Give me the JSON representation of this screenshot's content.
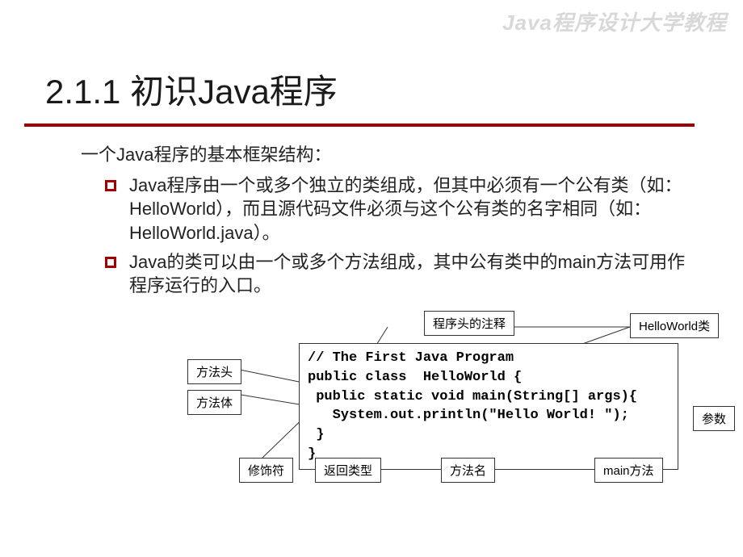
{
  "watermark": "Java程序设计大学教程",
  "title": "2.1.1 初识Java程序",
  "intro": "一个Java程序的基本框架结构：",
  "bullets": [
    "Java程序由一个或多个独立的类组成，但其中必须有一个公有类（如：HelloWorld），而且源代码文件必须与这个公有类的名字相同（如：HelloWorld.java）。",
    "Java的类可以由一个或多个方法组成，其中公有类中的main方法可用作程序运行的入口。"
  ],
  "code": {
    "line1": "// The First Java Program",
    "line2": "public class  HelloWorld {",
    "line3": " public static void main(String[] args){",
    "line4": "   System.out.println(\"Hello World! \");",
    "line5": " }",
    "line6": "}"
  },
  "labels": {
    "comment": "程序头的注释",
    "class": "HelloWorld类",
    "methodHead": "方法头",
    "methodBody": "方法体",
    "modifier": "修饰符",
    "returnType": "返回类型",
    "methodName": "方法名",
    "mainMethod": "main方法",
    "param": "参数"
  }
}
